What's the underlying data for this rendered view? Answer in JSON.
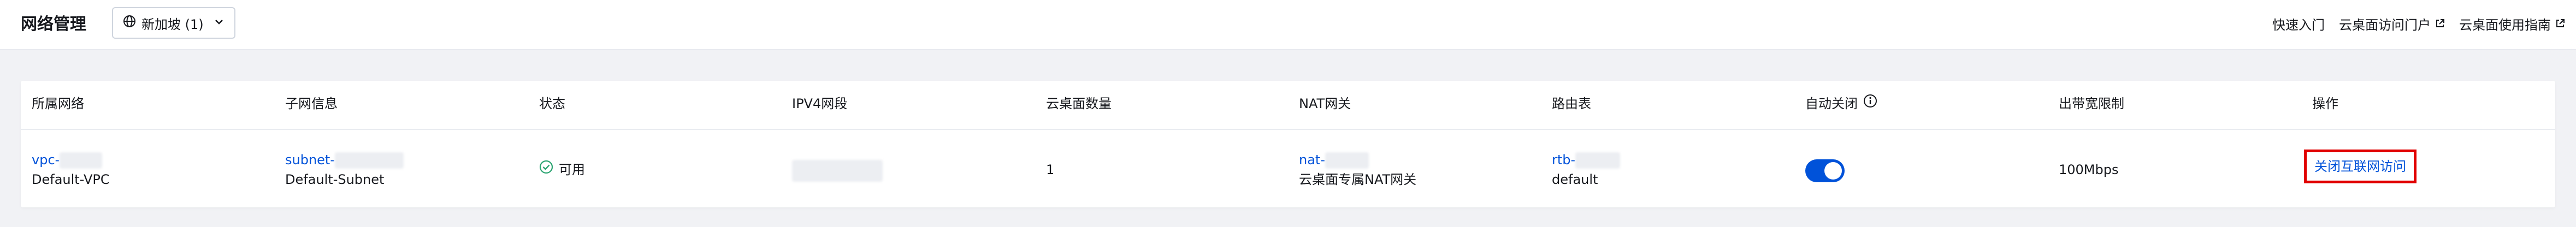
{
  "header": {
    "title": "网络管理",
    "region_label": "新加坡 (1)",
    "links": [
      {
        "label": "快速入门"
      },
      {
        "label": "云桌面访问门户"
      },
      {
        "label": "云桌面使用指南"
      }
    ]
  },
  "table": {
    "columns": [
      "所属网络",
      "子网信息",
      "状态",
      "IPV4网段",
      "云桌面数量",
      "NAT网关",
      "路由表",
      "自动关闭",
      "出带宽限制",
      "操作"
    ],
    "rows": [
      {
        "vpc_id": "vpc-",
        "vpc_name": "Default-VPC",
        "subnet_id": "subnet-",
        "subnet_name": "Default-Subnet",
        "status": "可用",
        "ipv4": "",
        "desktop_count": "1",
        "nat_id": "nat-",
        "nat_name": "云桌面专属NAT网关",
        "route_id": "rtb-",
        "route_name": "default",
        "auto_close": true,
        "bandwidth": "100Mbps",
        "action": "关闭互联网访问"
      }
    ]
  },
  "colors": {
    "accent": "#0052d9",
    "status_ok": "#2ba471",
    "highlight": "#e10000"
  },
  "icons": [
    "globe-icon",
    "chevron-down-icon",
    "external-link-icon",
    "info-icon",
    "check-circle-icon"
  ]
}
